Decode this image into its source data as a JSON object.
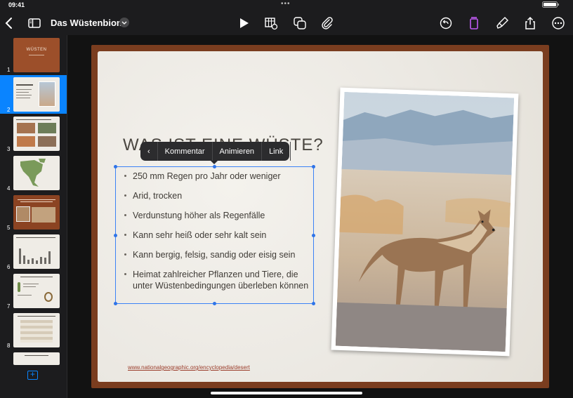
{
  "status": {
    "time": "09:41",
    "dots": "•••"
  },
  "toolbar": {
    "doc_title": "Das Wüstenbiom",
    "icons": [
      "back-chevron-icon",
      "sidebar-toggle-icon",
      "title-dropdown-icon",
      "play-icon",
      "table-insert-icon",
      "shapes-icon",
      "paperclip-icon",
      "undo-icon",
      "format-icon",
      "paintbrush-icon",
      "share-icon",
      "more-icon"
    ],
    "accent_color": "#bf5af2"
  },
  "sidebar": {
    "selected_index": 2,
    "slides": [
      {
        "number": "1",
        "label": "WÜSTEN"
      },
      {
        "number": "2"
      },
      {
        "number": "3"
      },
      {
        "number": "4"
      },
      {
        "number": "5"
      },
      {
        "number": "6"
      },
      {
        "number": "7"
      },
      {
        "number": "8"
      }
    ],
    "add_label": "+"
  },
  "slide": {
    "title": "WAS IST EINE WÜSTE?",
    "bullets": [
      "250 mm Regen pro Jahr oder weniger",
      "Arid, trocken",
      "Verdunstung höher als Regenfälle",
      "Kann sehr heiß oder sehr kalt sein",
      "Kann bergig, felsig, sandig oder eisig sein",
      "Heimat zahlreicher Pflanzen und Tiere, die unter Wüstenbedingungen überleben können"
    ],
    "source": "www.nationalgeographic.org/encyclopedia/desert",
    "frame_color": "#7a3d1f"
  },
  "context_menu": {
    "back": "‹",
    "items": [
      "Kommentar",
      "Animieren",
      "Link"
    ]
  }
}
